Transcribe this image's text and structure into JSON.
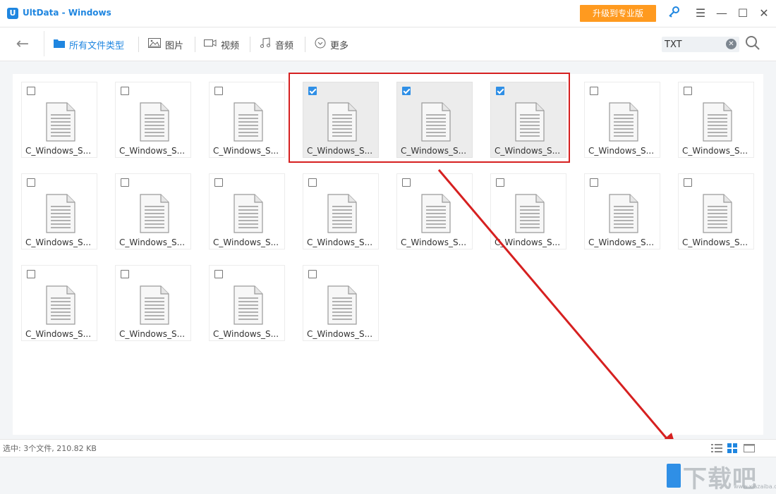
{
  "window": {
    "app_title": "UltData - Windows",
    "logo_letter": "U",
    "upgrade_label": "升级到专业版"
  },
  "toolbar": {
    "tabs": [
      {
        "label": "所有文件类型",
        "icon": "folder-icon",
        "active": true
      },
      {
        "label": "图片",
        "icon": "image-icon",
        "active": false
      },
      {
        "label": "视频",
        "icon": "video-icon",
        "active": false
      },
      {
        "label": "音频",
        "icon": "music-icon",
        "active": false
      },
      {
        "label": "更多",
        "icon": "more-icon",
        "active": false
      }
    ],
    "search_value": "TXT"
  },
  "files": [
    {
      "name": "C_Windows_S...",
      "checked": false
    },
    {
      "name": "C_Windows_S...",
      "checked": false
    },
    {
      "name": "C_Windows_S...",
      "checked": false
    },
    {
      "name": "C_Windows_S...",
      "checked": true
    },
    {
      "name": "C_Windows_S...",
      "checked": true
    },
    {
      "name": "C_Windows_S...",
      "checked": true
    },
    {
      "name": "C_Windows_S...",
      "checked": false
    },
    {
      "name": "C_Windows_S...",
      "checked": false
    },
    {
      "name": "C_Windows_S...",
      "checked": false
    },
    {
      "name": "C_Windows_S...",
      "checked": false
    },
    {
      "name": "C_Windows_S...",
      "checked": false
    },
    {
      "name": "C_Windows_S...",
      "checked": false
    },
    {
      "name": "C_Windows_S...",
      "checked": false
    },
    {
      "name": "C_Windows_S...",
      "checked": false
    },
    {
      "name": "C_Windows_S...",
      "checked": false
    },
    {
      "name": "C_Windows_S...",
      "checked": false
    },
    {
      "name": "C_Windows_S...",
      "checked": false
    },
    {
      "name": "C_Windows_S...",
      "checked": false
    },
    {
      "name": "C_Windows_S...",
      "checked": false
    },
    {
      "name": "C_Windows_S...",
      "checked": false
    }
  ],
  "status": {
    "selection_text": "选中: 3个文件, 210.82 KB"
  },
  "view_modes": [
    "list-view-icon",
    "grid-view-icon",
    "large-view-icon"
  ],
  "watermark": {
    "text": "下载吧",
    "sub": "www.xiazaiba.com"
  },
  "colors": {
    "accent": "#1f86e0",
    "upgrade": "#ff9a1f",
    "annotation": "#d62020"
  }
}
